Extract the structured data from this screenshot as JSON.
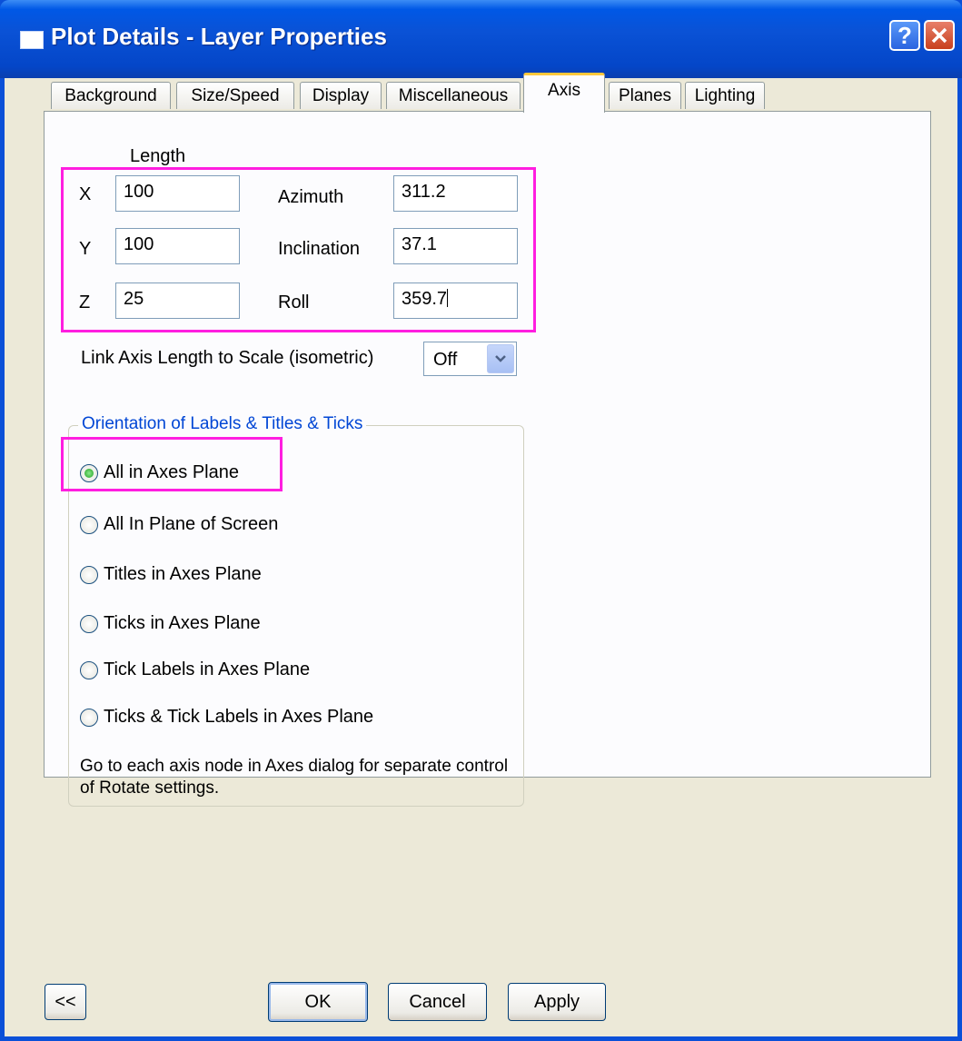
{
  "window": {
    "title": "Plot Details - Layer Properties"
  },
  "tabs": [
    {
      "label": "Background"
    },
    {
      "label": "Size/Speed"
    },
    {
      "label": "Display"
    },
    {
      "label": "Miscellaneous"
    },
    {
      "label": "Axis",
      "active": true
    },
    {
      "label": "Planes"
    },
    {
      "label": "Lighting"
    }
  ],
  "axis": {
    "length_header": "Length",
    "x_label": "X",
    "x_value": "100",
    "y_label": "Y",
    "y_value": "100",
    "z_label": "Z",
    "z_value": "25",
    "azimuth_label": "Azimuth",
    "azimuth_value": "311.2",
    "inclination_label": "Inclination",
    "inclination_value": "37.1",
    "roll_label": "Roll",
    "roll_value": "359.7",
    "link_label": "Link Axis Length to Scale (isometric)",
    "link_value": "Off"
  },
  "orientation": {
    "legend": "Orientation of Labels & Titles & Ticks",
    "options": [
      {
        "label": "All in Axes Plane",
        "selected": true
      },
      {
        "label": "All In Plane of Screen",
        "selected": false
      },
      {
        "label": "Titles in Axes Plane",
        "selected": false
      },
      {
        "label": "Ticks in Axes Plane",
        "selected": false
      },
      {
        "label": "Tick Labels in Axes Plane",
        "selected": false
      },
      {
        "label": "Ticks & Tick Labels in Axes Plane",
        "selected": false
      }
    ],
    "note": "Go to each axis node in Axes dialog for separate control of Rotate settings."
  },
  "buttons": {
    "collapse": "<<",
    "ok": "OK",
    "cancel": "Cancel",
    "apply": "Apply"
  },
  "colors": {
    "highlight": "#ff1ee0",
    "titlebar": "#0a52d6",
    "legend_text": "#0046d5"
  }
}
